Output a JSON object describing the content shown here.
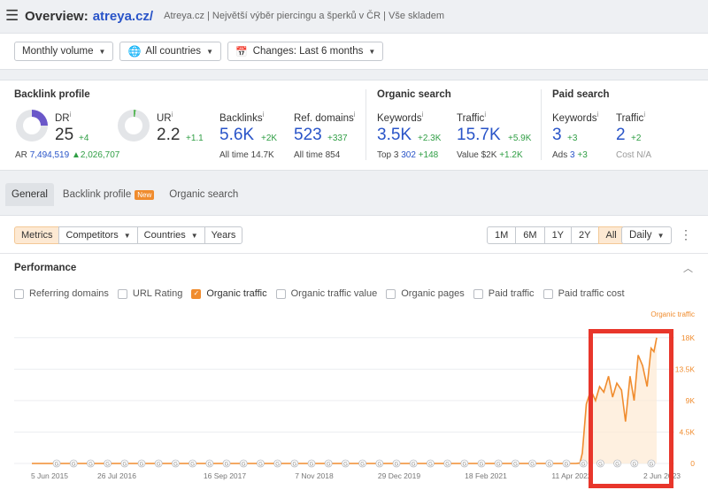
{
  "header": {
    "menu_icon": "hamburger-icon",
    "title_prefix": "Overview:",
    "domain": "atreya.cz/",
    "site_description": "Atreya.cz | Největší výběr piercingu a šperků v ČR | Vše skladem"
  },
  "filters": {
    "volume": "Monthly volume",
    "country": "All countries",
    "changes": "Changes: Last 6 months"
  },
  "backlink_profile": {
    "title": "Backlink profile",
    "dr": {
      "label": "DR",
      "value": "25",
      "delta": "+4",
      "fill": 0.25
    },
    "ur": {
      "label": "UR",
      "value": "2.2",
      "delta": "+1.1",
      "fill": 0.022
    },
    "ar": {
      "label": "AR",
      "value": "7,494,519",
      "delta": "▲2,026,707"
    },
    "backlinks": {
      "label": "Backlinks",
      "value": "5.6K",
      "delta": "+2K",
      "sub_label": "All time",
      "sub_value": "14.7K"
    },
    "ref_domains": {
      "label": "Ref. domains",
      "value": "523",
      "delta": "+337",
      "sub_label": "All time",
      "sub_value": "854"
    }
  },
  "organic_search": {
    "title": "Organic search",
    "keywords": {
      "label": "Keywords",
      "value": "3.5K",
      "delta": "+2.3K",
      "sub_label": "Top 3",
      "sub_value": "302",
      "sub_delta": "+148"
    },
    "traffic": {
      "label": "Traffic",
      "value": "15.7K",
      "delta": "+5.9K",
      "sub_label": "Value",
      "sub_value": "$2K",
      "sub_delta": "+1.2K"
    }
  },
  "paid_search": {
    "title": "Paid search",
    "keywords": {
      "label": "Keywords",
      "value": "3",
      "delta": "+3",
      "sub_label": "Ads",
      "sub_value": "3",
      "sub_delta": "+3"
    },
    "traffic": {
      "label": "Traffic",
      "value": "2",
      "delta": "+2",
      "sub_label": "Cost",
      "sub_value": "N/A"
    }
  },
  "tabs": [
    {
      "label": "General",
      "active": true
    },
    {
      "label": "Backlink profile",
      "badge": "New"
    },
    {
      "label": "Organic search"
    }
  ],
  "controls": {
    "left": [
      "Metrics",
      "Competitors",
      "Countries",
      "Years"
    ],
    "ranges": [
      "1M",
      "6M",
      "1Y",
      "2Y",
      "All"
    ],
    "active_range": "All",
    "granularity": "Daily"
  },
  "performance": {
    "title": "Performance",
    "checkboxes": [
      {
        "label": "Referring domains",
        "checked": false
      },
      {
        "label": "URL Rating",
        "checked": false
      },
      {
        "label": "Organic traffic",
        "checked": true
      },
      {
        "label": "Organic traffic value",
        "checked": false
      },
      {
        "label": "Organic pages",
        "checked": false
      },
      {
        "label": "Paid traffic",
        "checked": false
      },
      {
        "label": "Paid traffic cost",
        "checked": false
      }
    ]
  },
  "chart_data": {
    "type": "line",
    "series": [
      {
        "name": "Organic traffic",
        "color": "#f08c2e",
        "x": [
          "2015-06-05",
          "2021-01-01",
          "2022-01-01",
          "2022-06-01",
          "2022-06-20",
          "2022-07-01",
          "2022-07-20",
          "2022-08-10",
          "2022-09-01",
          "2022-09-20",
          "2022-10-10",
          "2022-11-01",
          "2022-11-20",
          "2022-12-10",
          "2023-01-01",
          "2023-01-20",
          "2023-02-10",
          "2023-03-01",
          "2023-03-20",
          "2023-04-10",
          "2023-05-01",
          "2023-05-20",
          "2023-06-02",
          "2023-06-15"
        ],
        "y": [
          0,
          0,
          0,
          0,
          50,
          1500,
          8500,
          10500,
          9000,
          11000,
          10200,
          12500,
          9500,
          11500,
          10500,
          6000,
          12500,
          9000,
          15500,
          14000,
          11000,
          16500,
          16000,
          18000
        ]
      }
    ],
    "x_tick_labels": [
      "5 Jun 2015",
      "26 Jul 2016",
      "16 Sep 2017",
      "7 Nov 2018",
      "29 Dec 2019",
      "18 Feb 2021",
      "11 Apr 2022",
      "2 Jun 2023"
    ],
    "y_tick_labels": [
      "0",
      "4.5K",
      "9K",
      "13.5K",
      "18K"
    ],
    "y_axis_title": "Organic traffic",
    "ylim": [
      0,
      20000
    ],
    "grid": true,
    "marker_label": "G",
    "marker_count": 36,
    "highlight": "red box around the recent traffic spike"
  }
}
